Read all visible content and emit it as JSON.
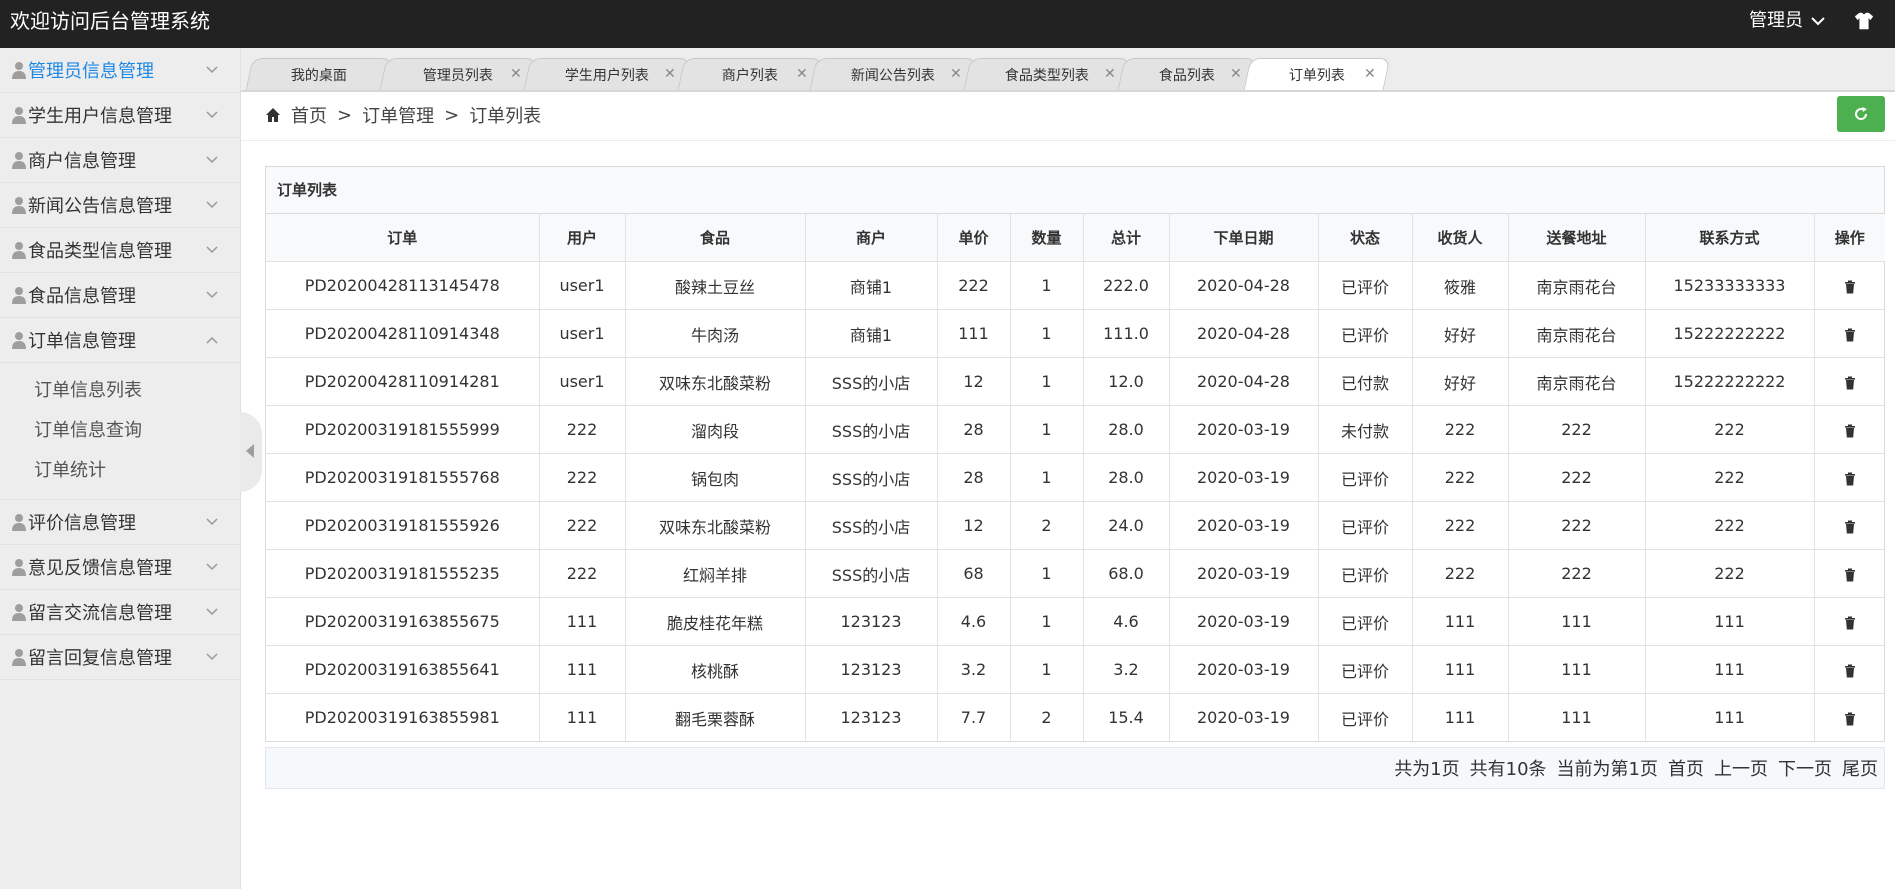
{
  "header": {
    "title": "欢迎访问后台管理系统",
    "admin_label": "管理员"
  },
  "sidebar": {
    "items": [
      {
        "label": "管理员信息管理",
        "active": true
      },
      {
        "label": "学生用户信息管理"
      },
      {
        "label": "商户信息管理"
      },
      {
        "label": "新闻公告信息管理"
      },
      {
        "label": "食品类型信息管理"
      },
      {
        "label": "食品信息管理"
      },
      {
        "label": "订单信息管理",
        "expanded": true
      },
      {
        "label": "评价信息管理"
      },
      {
        "label": "意见反馈信息管理"
      },
      {
        "label": "留言交流信息管理"
      },
      {
        "label": "留言回复信息管理"
      }
    ],
    "submenu": [
      "订单信息列表",
      "订单信息查询",
      "订单统计"
    ]
  },
  "tabs": [
    {
      "label": "我的桌面",
      "closable": false
    },
    {
      "label": "管理员列表",
      "closable": true
    },
    {
      "label": "学生用户列表",
      "closable": true
    },
    {
      "label": "商户列表",
      "closable": true
    },
    {
      "label": "新闻公告列表",
      "closable": true
    },
    {
      "label": "食品类型列表",
      "closable": true
    },
    {
      "label": "食品列表",
      "closable": true
    },
    {
      "label": "订单列表",
      "closable": true,
      "active": true
    }
  ],
  "breadcrumb": {
    "home": "首页",
    "sep": ">",
    "level1": "订单管理",
    "level2": "订单列表"
  },
  "table": {
    "title": "订单列表",
    "columns": [
      "订单",
      "用户",
      "食品",
      "商户",
      "单价",
      "数量",
      "总计",
      "下单日期",
      "状态",
      "收货人",
      "送餐地址",
      "联系方式",
      "操作"
    ],
    "rows": [
      [
        "PD20200428113145478",
        "user1",
        "酸辣土豆丝",
        "商铺1",
        "222",
        "1",
        "222.0",
        "2020-04-28",
        "已评价",
        "筱雅",
        "南京雨花台",
        "15233333333"
      ],
      [
        "PD20200428110914348",
        "user1",
        "牛肉汤",
        "商铺1",
        "111",
        "1",
        "111.0",
        "2020-04-28",
        "已评价",
        "好好",
        "南京雨花台",
        "15222222222"
      ],
      [
        "PD20200428110914281",
        "user1",
        "双味东北酸菜粉",
        "SSS的小店",
        "12",
        "1",
        "12.0",
        "2020-04-28",
        "已付款",
        "好好",
        "南京雨花台",
        "15222222222"
      ],
      [
        "PD20200319181555999",
        "222",
        "溜肉段",
        "SSS的小店",
        "28",
        "1",
        "28.0",
        "2020-03-19",
        "未付款",
        "222",
        "222",
        "222"
      ],
      [
        "PD20200319181555768",
        "222",
        "锅包肉",
        "SSS的小店",
        "28",
        "1",
        "28.0",
        "2020-03-19",
        "已评价",
        "222",
        "222",
        "222"
      ],
      [
        "PD20200319181555926",
        "222",
        "双味东北酸菜粉",
        "SSS的小店",
        "12",
        "2",
        "24.0",
        "2020-03-19",
        "已评价",
        "222",
        "222",
        "222"
      ],
      [
        "PD20200319181555235",
        "222",
        "红焖羊排",
        "SSS的小店",
        "68",
        "1",
        "68.0",
        "2020-03-19",
        "已评价",
        "222",
        "222",
        "222"
      ],
      [
        "PD20200319163855675",
        "111",
        "脆皮桂花年糕",
        "123123",
        "4.6",
        "1",
        "4.6",
        "2020-03-19",
        "已评价",
        "111",
        "111",
        "111"
      ],
      [
        "PD20200319163855641",
        "111",
        "核桃酥",
        "123123",
        "3.2",
        "1",
        "3.2",
        "2020-03-19",
        "已评价",
        "111",
        "111",
        "111"
      ],
      [
        "PD20200319163855981",
        "111",
        "翻毛栗蓉酥",
        "123123",
        "7.7",
        "2",
        "15.4",
        "2020-03-19",
        "已评价",
        "111",
        "111",
        "111"
      ]
    ]
  },
  "pagination": {
    "total_pages": "共为1页",
    "total_records": "共有10条",
    "current_page": "当前为第1页",
    "first": "首页",
    "prev": "上一页",
    "next": "下一页",
    "last": "尾页"
  },
  "colors": {
    "accent": "#1e88e5",
    "header_bg": "#222222",
    "refresh": "#4cb050"
  }
}
